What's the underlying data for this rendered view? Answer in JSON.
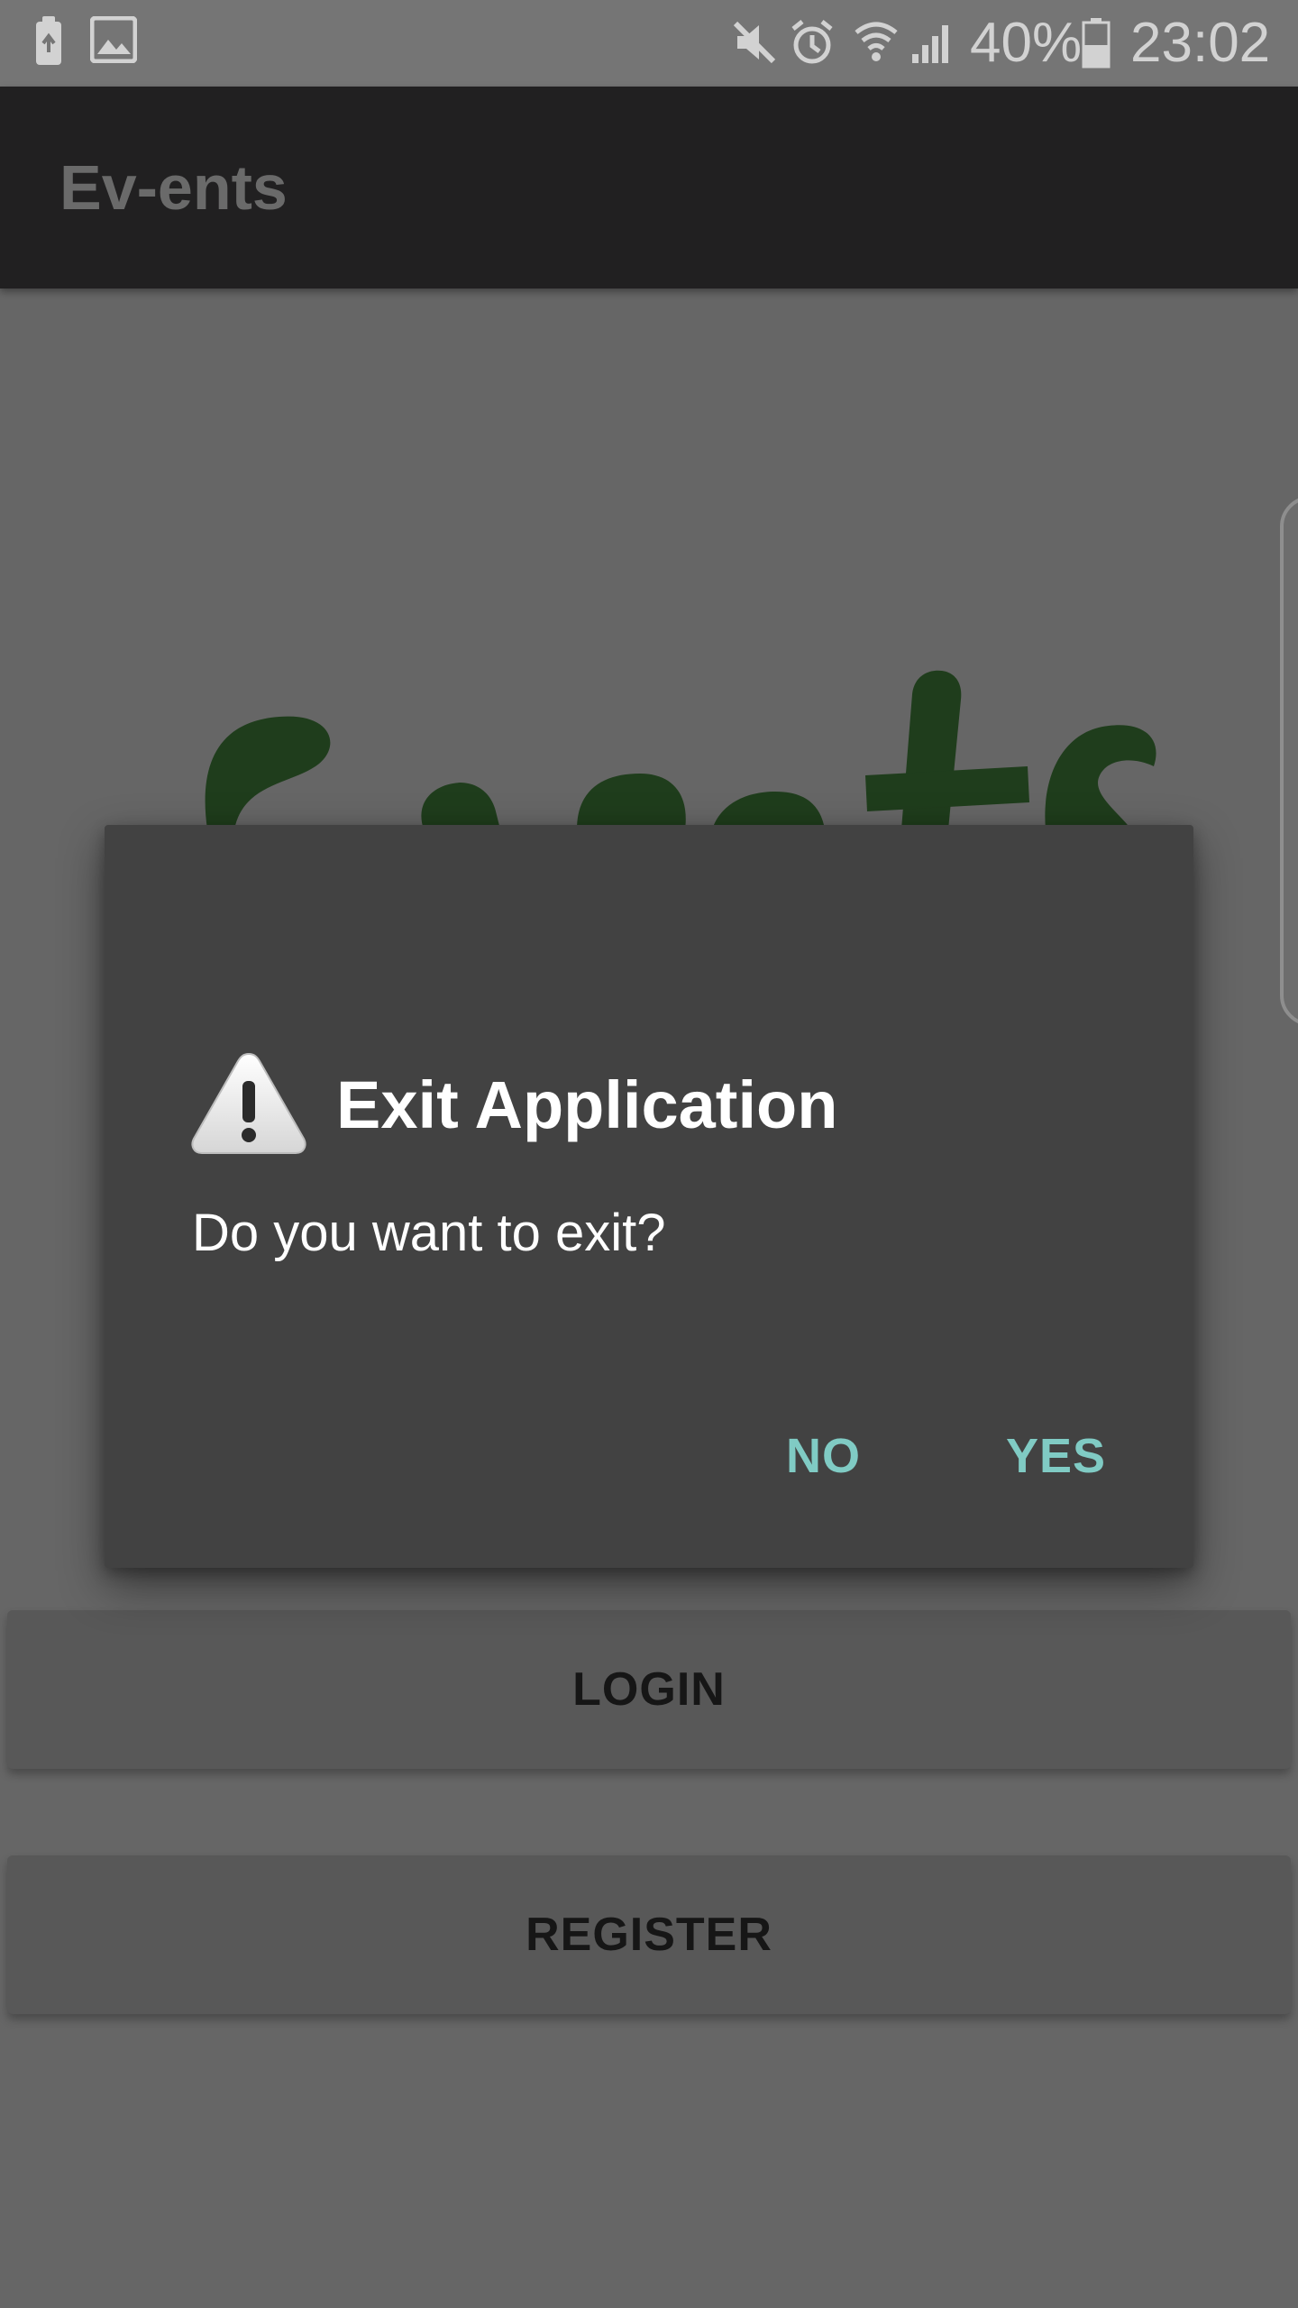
{
  "status_bar": {
    "icons": [
      "battery-saver-icon",
      "gallery-icon",
      "mute-icon",
      "alarm-icon",
      "wifi-icon",
      "cell-signal-icon",
      "battery-icon"
    ],
    "battery_percent": "40%",
    "time": "23:02"
  },
  "app_bar": {
    "title": "Ev-ents"
  },
  "background": {
    "logo_text": "Events",
    "logo_color": "#1f3d1c",
    "login_label": "LOGIN",
    "register_label": "REGISTER"
  },
  "dialog": {
    "icon": "warning-icon",
    "title": "Exit Application",
    "message": "Do you want to exit?",
    "negative_label": "NO",
    "positive_label": "YES",
    "accent_color": "#80cbc4"
  }
}
